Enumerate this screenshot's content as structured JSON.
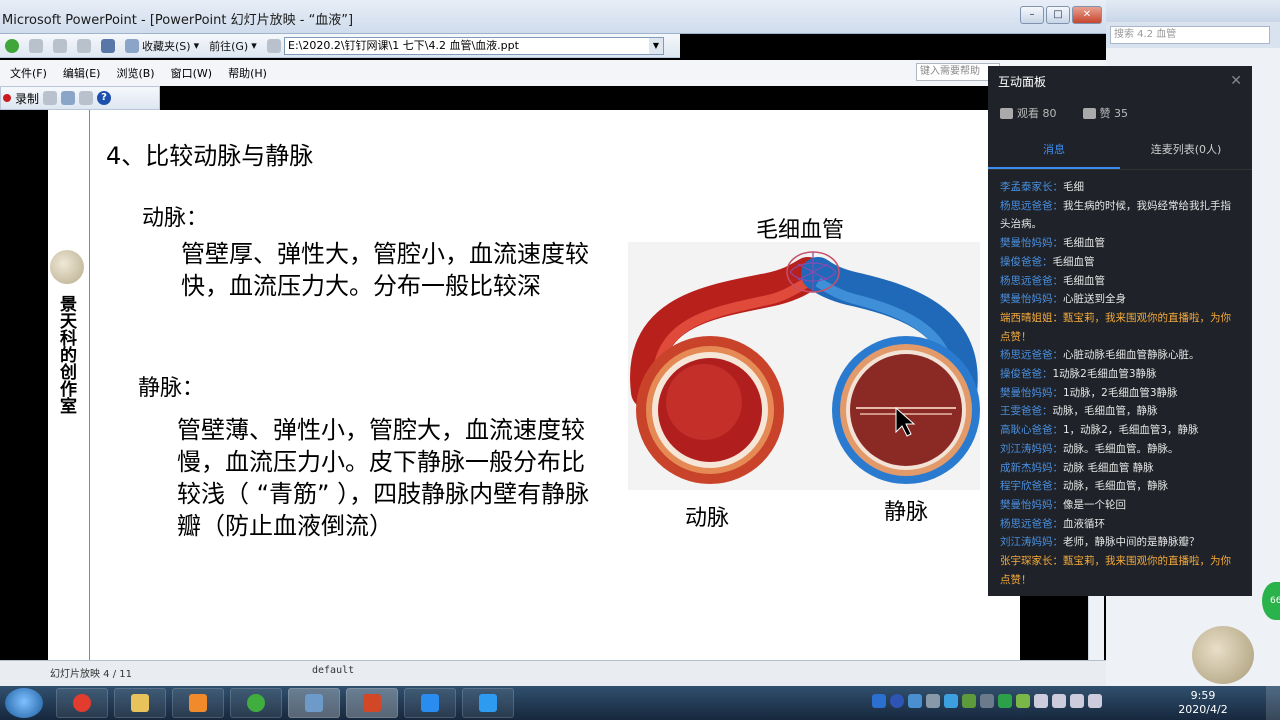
{
  "window": {
    "title": "Microsoft PowerPoint - [PowerPoint 幻灯片放映 - “血液”]",
    "controls": [
      "–",
      "□",
      "✕"
    ]
  },
  "toolbar": {
    "favorites_label": "收藏夹(S)",
    "goto_label": "前往(G)",
    "address": "E:\\2020.2\\钉钉网课\\1 七下\\4.2 血管\\血液.ppt"
  },
  "menubar": {
    "items": [
      "文件(F)",
      "编辑(E)",
      "浏览(B)",
      "窗口(W)",
      "帮助(H)"
    ],
    "help_placeholder": "键入需要帮助"
  },
  "toolbar2": {
    "record_label": "录制"
  },
  "browser_side": {
    "search_placeholder": "搜索 4.2 血管"
  },
  "slide": {
    "side_title": "景天科的创作室",
    "title": "4、比较动脉与静脉",
    "artery_label": "动脉：",
    "artery_desc": "管壁厚、弹性大，管腔小，血流速度较快，血流压力大。分布一般比较深",
    "vein_label": "静脉：",
    "vein_desc": "管壁薄、弹性小，管腔大，血流速度较慢，血流压力小。皮下静脉一般分布比较浅（ “青筋” ），四肢静脉内壁有静脉瓣（防止血液倒流）",
    "capillary_label": "毛细血管",
    "artery_caption": "动脉",
    "vein_caption": "静脉",
    "watermark": "景天科的创作室"
  },
  "status": {
    "slide_info": "幻灯片放映 4 / 11",
    "design": "default"
  },
  "panel": {
    "title": "互动面板",
    "viewers_label": "观看 80",
    "likes_label": "赞 35",
    "tabs": [
      "消息",
      "连麦列表(0人)"
    ],
    "messages": [
      {
        "name": "李孟泰家长：",
        "text": "毛细",
        "highlight": false
      },
      {
        "name": "杨思远爸爸：",
        "text": "我生病的时候，我妈经常给我扎手指头治病。",
        "highlight": false
      },
      {
        "name": "樊曼怡妈妈：",
        "text": "毛细血管",
        "highlight": false
      },
      {
        "name": "操俊爸爸：",
        "text": "毛细血管",
        "highlight": false
      },
      {
        "name": "杨思远爸爸：",
        "text": "毛细血管",
        "highlight": false
      },
      {
        "name": "樊曼怡妈妈：",
        "text": "心脏送到全身",
        "highlight": false
      },
      {
        "name": "端西晴姐姐：",
        "text": "甄宝莉，我来围观你的直播啦，为你点赞！",
        "highlight": true
      },
      {
        "name": "杨思远爸爸：",
        "text": "心脏动脉毛细血管静脉心脏。",
        "highlight": false
      },
      {
        "name": "操俊爸爸：",
        "text": "1动脉2毛细血管3静脉",
        "highlight": false
      },
      {
        "name": "樊曼怡妈妈：",
        "text": "1动脉，2毛细血管3静脉",
        "highlight": false
      },
      {
        "name": "王雯爸爸：",
        "text": "动脉，毛细血管，静脉",
        "highlight": false
      },
      {
        "name": "高耿心爸爸：",
        "text": "1，动脉2，毛细血管3，静脉",
        "highlight": false
      },
      {
        "name": "刘江涛妈妈：",
        "text": "动脉。毛细血管。静脉。",
        "highlight": false
      },
      {
        "name": "成新杰妈妈：",
        "text": "动脉 毛细血管 静脉",
        "highlight": false
      },
      {
        "name": "程宇欣爸爸：",
        "text": "动脉，毛细血管，静脉",
        "highlight": false
      },
      {
        "name": "樊曼怡妈妈：",
        "text": "像是一个轮回",
        "highlight": false
      },
      {
        "name": "杨思远爸爸：",
        "text": "血液循环",
        "highlight": false
      },
      {
        "name": "刘江涛妈妈：",
        "text": "老师，静脉中间的是静脉瓣？",
        "highlight": false
      },
      {
        "name": "张宇琛家长：",
        "text": "甄宝莉，我来围观你的直播啦，为你点赞！",
        "highlight": true
      }
    ]
  },
  "green_badge": "66",
  "taskbar": {
    "time": "9:59",
    "date": "2020/4/2"
  }
}
